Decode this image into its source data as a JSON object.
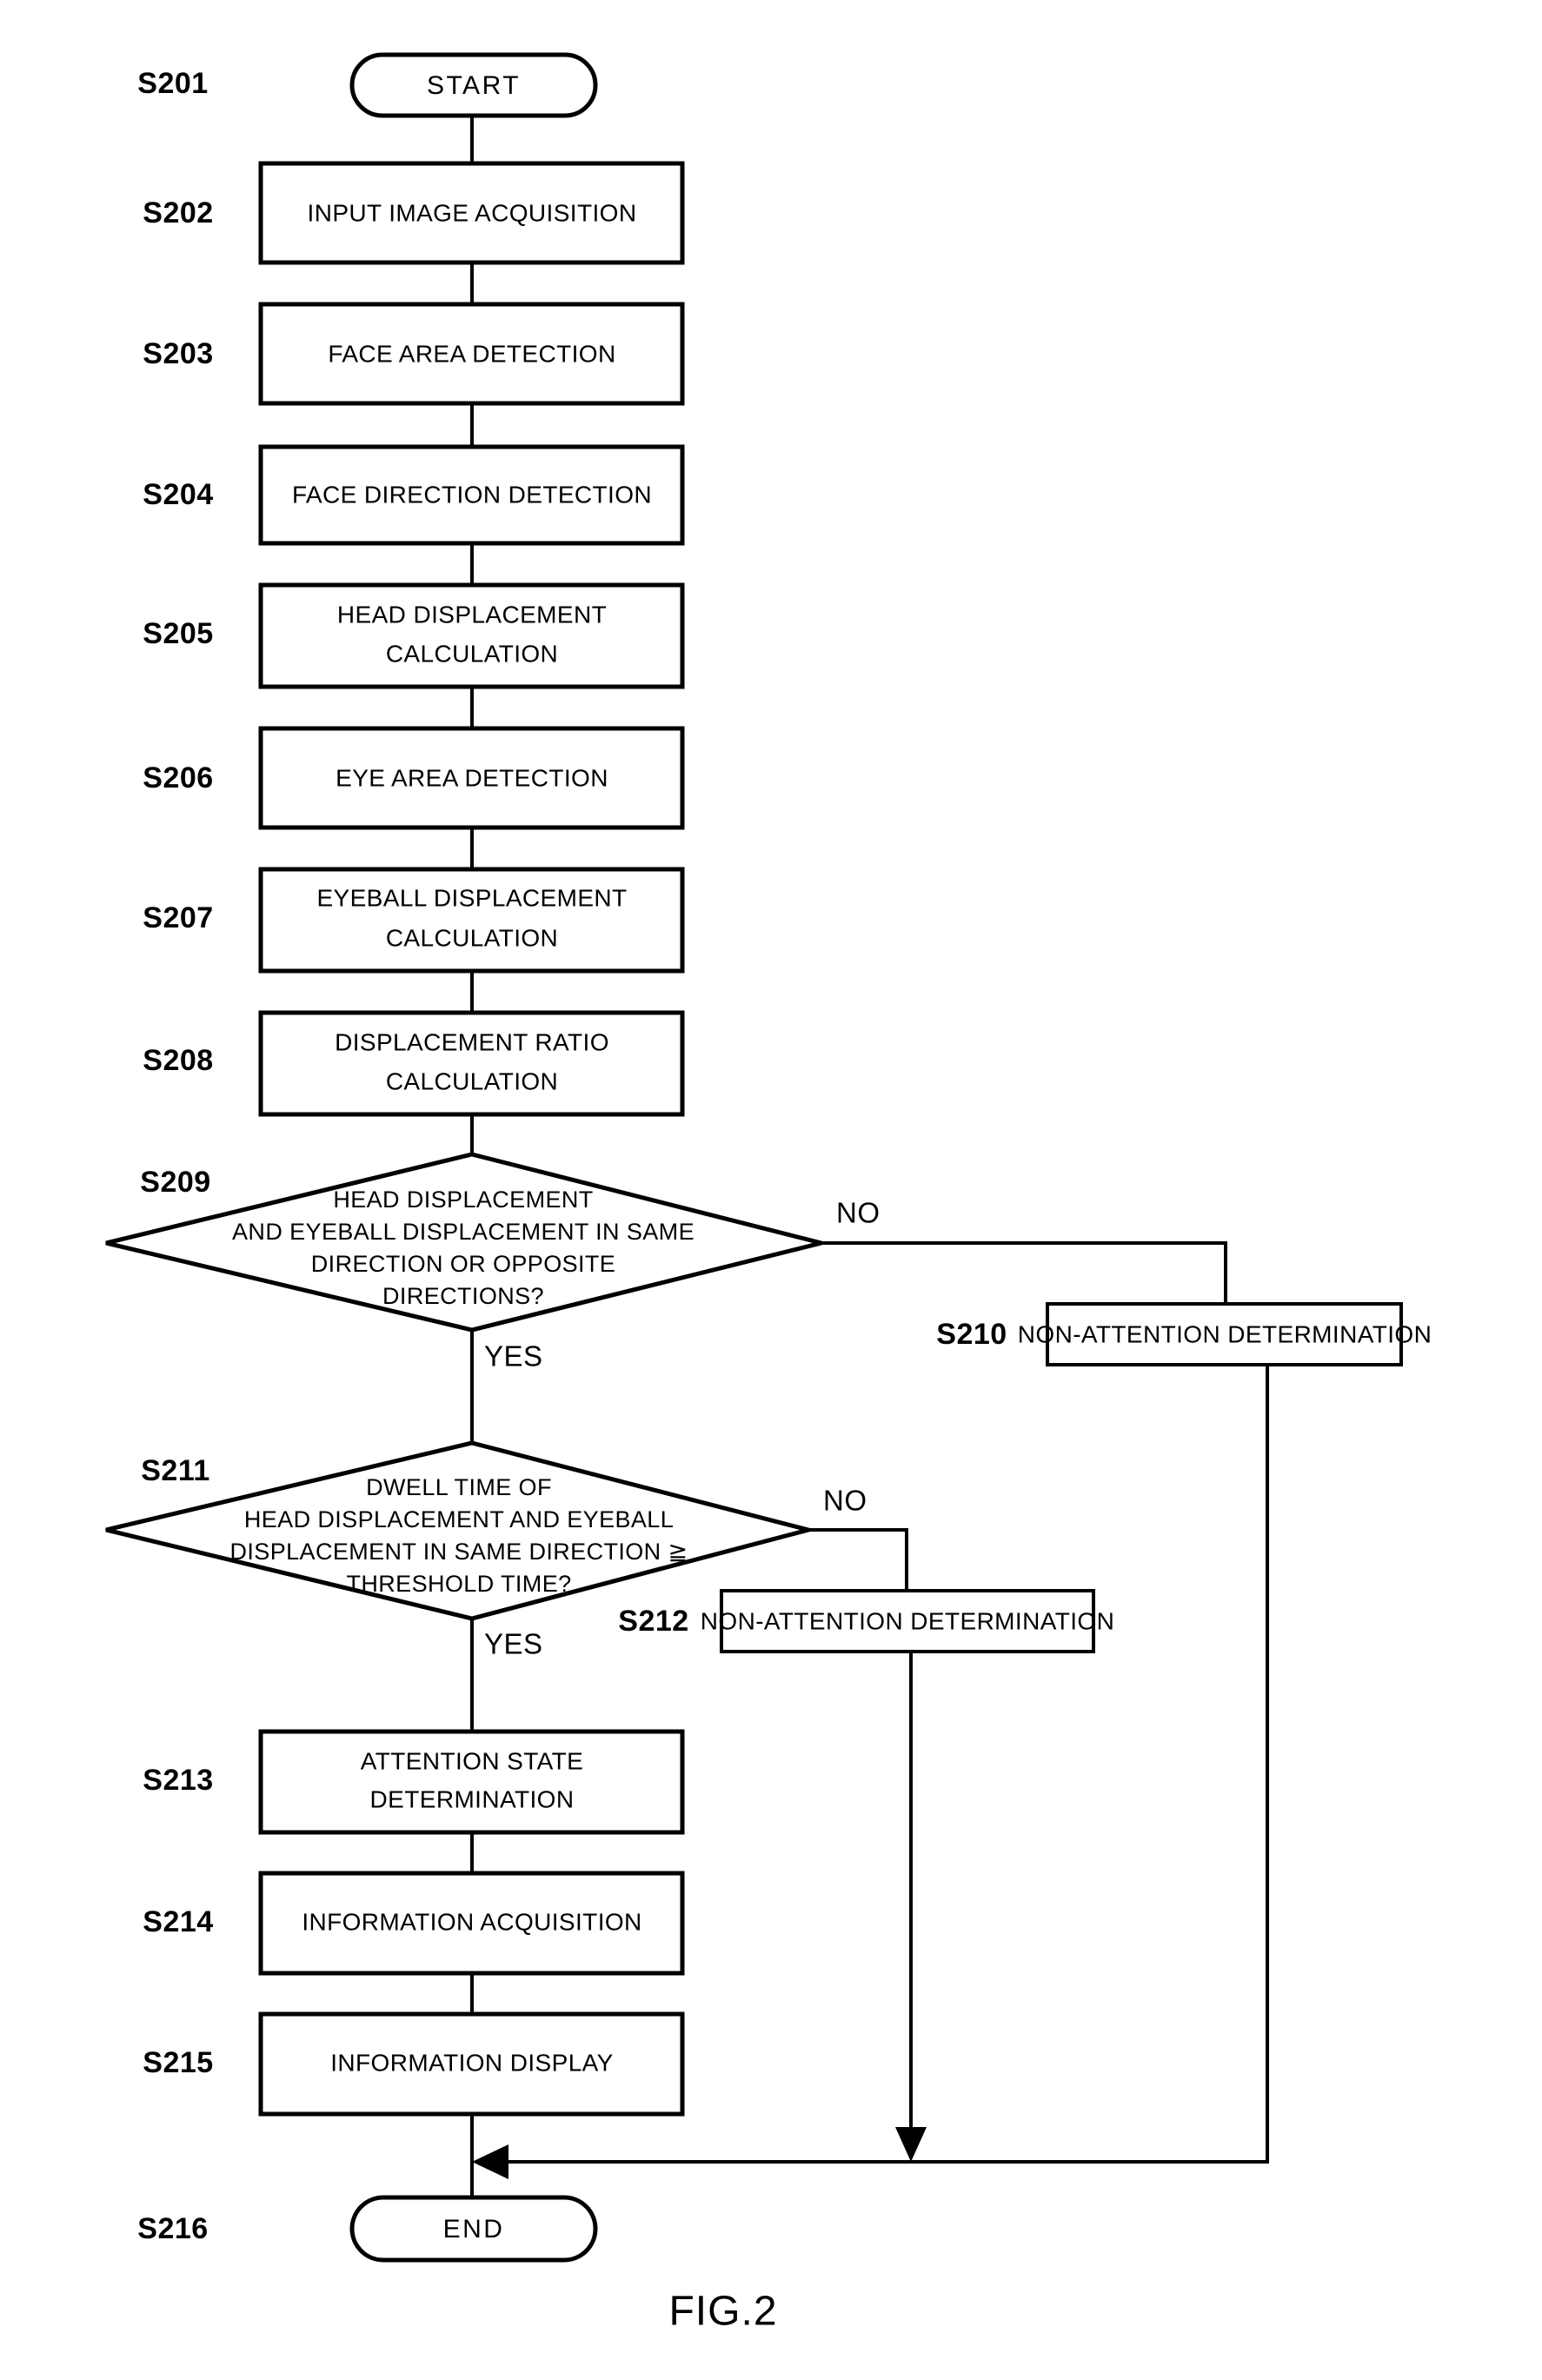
{
  "figure": {
    "caption": "FIG.2",
    "type": "flowchart"
  },
  "diagram_data": {
    "type": "flowchart",
    "title": "FIG.2",
    "nodes": [
      {
        "id": "S201",
        "step": "S201",
        "shape": "terminator",
        "label": "START"
      },
      {
        "id": "S202",
        "step": "S202",
        "shape": "process",
        "label": "INPUT IMAGE ACQUISITION"
      },
      {
        "id": "S203",
        "step": "S203",
        "shape": "process",
        "label": "FACE AREA DETECTION"
      },
      {
        "id": "S204",
        "step": "S204",
        "shape": "process",
        "label": "FACE DIRECTION DETECTION"
      },
      {
        "id": "S205",
        "step": "S205",
        "shape": "process",
        "label": "HEAD DISPLACEMENT CALCULATION"
      },
      {
        "id": "S206",
        "step": "S206",
        "shape": "process",
        "label": "EYE AREA DETECTION"
      },
      {
        "id": "S207",
        "step": "S207",
        "shape": "process",
        "label": "EYEBALL DISPLACEMENT CALCULATION"
      },
      {
        "id": "S208",
        "step": "S208",
        "shape": "process",
        "label": "DISPLACEMENT RATIO CALCULATION"
      },
      {
        "id": "S209",
        "step": "S209",
        "shape": "decision",
        "label": "HEAD DISPLACEMENT AND EYEBALL DISPLACEMENT IN SAME DIRECTION OR OPPOSITE DIRECTIONS?"
      },
      {
        "id": "S210",
        "step": "S210",
        "shape": "process",
        "label": "NON-ATTENTION DETERMINATION"
      },
      {
        "id": "S211",
        "step": "S211",
        "shape": "decision",
        "label": "DWELL TIME OF HEAD DISPLACEMENT AND EYEBALL DISPLACEMENT IN SAME DIRECTION ≧ THRESHOLD TIME?"
      },
      {
        "id": "S212",
        "step": "S212",
        "shape": "process",
        "label": "NON-ATTENTION DETERMINATION"
      },
      {
        "id": "S213",
        "step": "S213",
        "shape": "process",
        "label": "ATTENTION STATE DETERMINATION"
      },
      {
        "id": "S214",
        "step": "S214",
        "shape": "process",
        "label": "INFORMATION ACQUISITION"
      },
      {
        "id": "S215",
        "step": "S215",
        "shape": "process",
        "label": "INFORMATION DISPLAY"
      },
      {
        "id": "S216",
        "step": "S216",
        "shape": "terminator",
        "label": "END"
      }
    ],
    "edges": [
      {
        "from": "S201",
        "to": "S202",
        "label": ""
      },
      {
        "from": "S202",
        "to": "S203",
        "label": ""
      },
      {
        "from": "S203",
        "to": "S204",
        "label": ""
      },
      {
        "from": "S204",
        "to": "S205",
        "label": ""
      },
      {
        "from": "S205",
        "to": "S206",
        "label": ""
      },
      {
        "from": "S206",
        "to": "S207",
        "label": ""
      },
      {
        "from": "S207",
        "to": "S208",
        "label": ""
      },
      {
        "from": "S208",
        "to": "S209",
        "label": ""
      },
      {
        "from": "S209",
        "to": "S210",
        "label": "NO"
      },
      {
        "from": "S209",
        "to": "S211",
        "label": "YES"
      },
      {
        "from": "S211",
        "to": "S212",
        "label": "NO"
      },
      {
        "from": "S211",
        "to": "S213",
        "label": "YES"
      },
      {
        "from": "S213",
        "to": "S214",
        "label": ""
      },
      {
        "from": "S214",
        "to": "S215",
        "label": ""
      },
      {
        "from": "S215",
        "to": "S216",
        "label": ""
      },
      {
        "from": "S210",
        "to": "S216",
        "label": ""
      },
      {
        "from": "S212",
        "to": "S216",
        "label": ""
      }
    ],
    "branch_labels": [
      "NO",
      "YES",
      "NO",
      "YES"
    ]
  },
  "steps": {
    "s201": "S201",
    "s202": "S202",
    "s203": "S203",
    "s204": "S204",
    "s205": "S205",
    "s206": "S206",
    "s207": "S207",
    "s208": "S208",
    "s209": "S209",
    "s210": "S210",
    "s211": "S211",
    "s212": "S212",
    "s213": "S213",
    "s214": "S214",
    "s215": "S215",
    "s216": "S216"
  },
  "labels": {
    "start": "START",
    "input_image_acquisition": "INPUT IMAGE ACQUISITION",
    "face_area_detection": "FACE AREA DETECTION",
    "face_direction_detection": "FACE DIRECTION DETECTION",
    "head_displacement_l1": "HEAD DISPLACEMENT",
    "head_displacement_l2": "CALCULATION",
    "eye_area_detection": "EYE AREA DETECTION",
    "eyeball_displacement_l1": "EYEBALL DISPLACEMENT",
    "eyeball_displacement_l2": "CALCULATION",
    "displacement_ratio_l1": "DISPLACEMENT RATIO",
    "displacement_ratio_l2": "CALCULATION",
    "decision209_l1": "HEAD DISPLACEMENT",
    "decision209_l2": "AND EYEBALL DISPLACEMENT IN SAME",
    "decision209_l3": "DIRECTION OR OPPOSITE",
    "decision209_l4": "DIRECTIONS?",
    "non_attention_determination_210": "NON-ATTENTION DETERMINATION",
    "decision211_l1": "DWELL TIME OF",
    "decision211_l2": "HEAD DISPLACEMENT AND EYEBALL",
    "decision211_l3": "DISPLACEMENT IN SAME DIRECTION ≧",
    "decision211_l4": "THRESHOLD TIME?",
    "non_attention_determination_212": "NON-ATTENTION DETERMINATION",
    "attention_state_l1": "ATTENTION STATE",
    "attention_state_l2": "DETERMINATION",
    "information_acquisition": "INFORMATION ACQUISITION",
    "information_display": "INFORMATION DISPLAY",
    "end": "END",
    "no_209": "NO",
    "yes_209": "YES",
    "no_211": "NO",
    "yes_211": "YES"
  },
  "colors": {
    "stroke": "#000000",
    "fill": "#ffffff",
    "background": "#ffffff"
  }
}
